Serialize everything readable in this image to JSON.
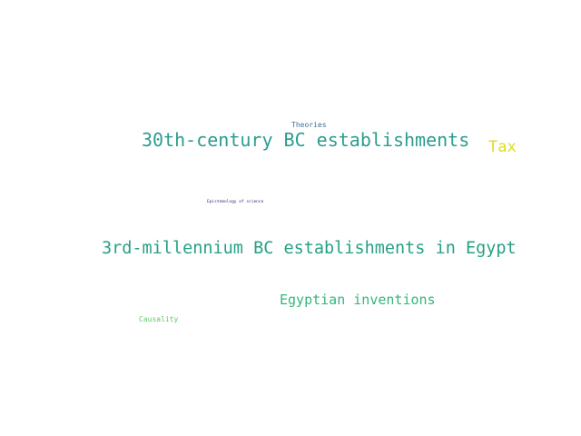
{
  "words": [
    {
      "text": "30th-century BC establishments",
      "color": "#2a9d8f"
    },
    {
      "text": "3rd-millennium BC establishments in Egypt",
      "color": "#26a085"
    },
    {
      "text": "Egyptian inventions",
      "color": "#35b779"
    },
    {
      "text": "Tax",
      "color": "#dddd22"
    },
    {
      "text": "Theories",
      "color": "#3f6f9a"
    },
    {
      "text": "Causality",
      "color": "#5ec962"
    },
    {
      "text": "Epistemology of science",
      "color": "#3b2a78"
    }
  ]
}
